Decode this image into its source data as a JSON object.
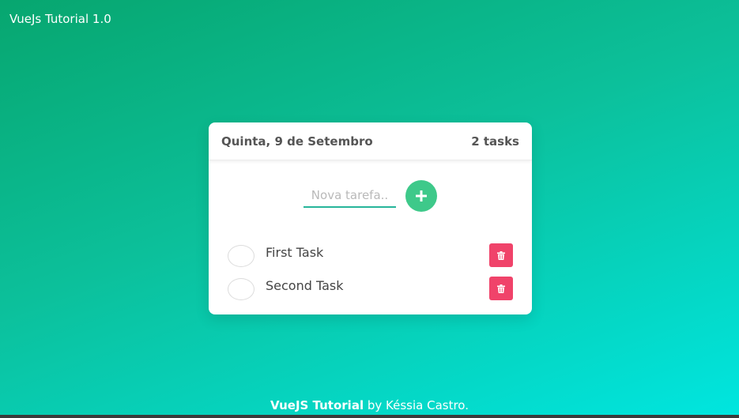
{
  "header": {
    "app_title": "VueJs Tutorial 1.0"
  },
  "card": {
    "date": "Quinta, 9 de Setembro",
    "task_count": "2 tasks",
    "input": {
      "placeholder": "Nova tarefa..",
      "value": ""
    },
    "add_icon": "plus-icon",
    "tasks": [
      {
        "label": "First Task",
        "done": false,
        "delete_icon": "trash-icon"
      },
      {
        "label": "Second Task",
        "done": false,
        "delete_icon": "trash-icon"
      }
    ]
  },
  "footer": {
    "brand": "VueJS Tutorial",
    "byline": " by Késsia Castro."
  },
  "colors": {
    "gradient_start": "#07a66f",
    "gradient_end": "#00e6e0",
    "add_button": "#3ec98a",
    "delete_button": "#f0436a",
    "input_underline": "#26b59a"
  }
}
